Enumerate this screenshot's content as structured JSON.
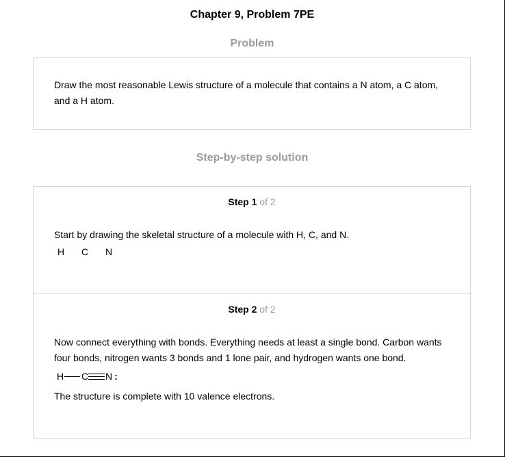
{
  "page": {
    "title": "Chapter 9, Problem 7PE"
  },
  "problem": {
    "heading": "Problem",
    "text": "Draw the most reasonable Lewis structure of a molecule that contains a N atom, a C atom, and a H atom."
  },
  "solution": {
    "heading": "Step-by-step solution",
    "steps": [
      {
        "label": "Step",
        "number": "1",
        "of_text": "of 2",
        "text": "Start by drawing the skeletal structure of a molecule with H, C, and N.",
        "atoms": [
          "H",
          "C",
          "N"
        ]
      },
      {
        "label": "Step",
        "number": "2",
        "of_text": "of 2",
        "text": "Now connect everything with bonds. Everything needs at least a single bond. Carbon wants four bonds, nitrogen wants 3 bonds and 1 lone pair, and hydrogen wants one bond.",
        "structure": {
          "h": "H",
          "c": "C",
          "n": "N",
          "lone_pair": ":"
        },
        "conclusion": "The structure is complete with 10 valence electrons."
      }
    ]
  }
}
